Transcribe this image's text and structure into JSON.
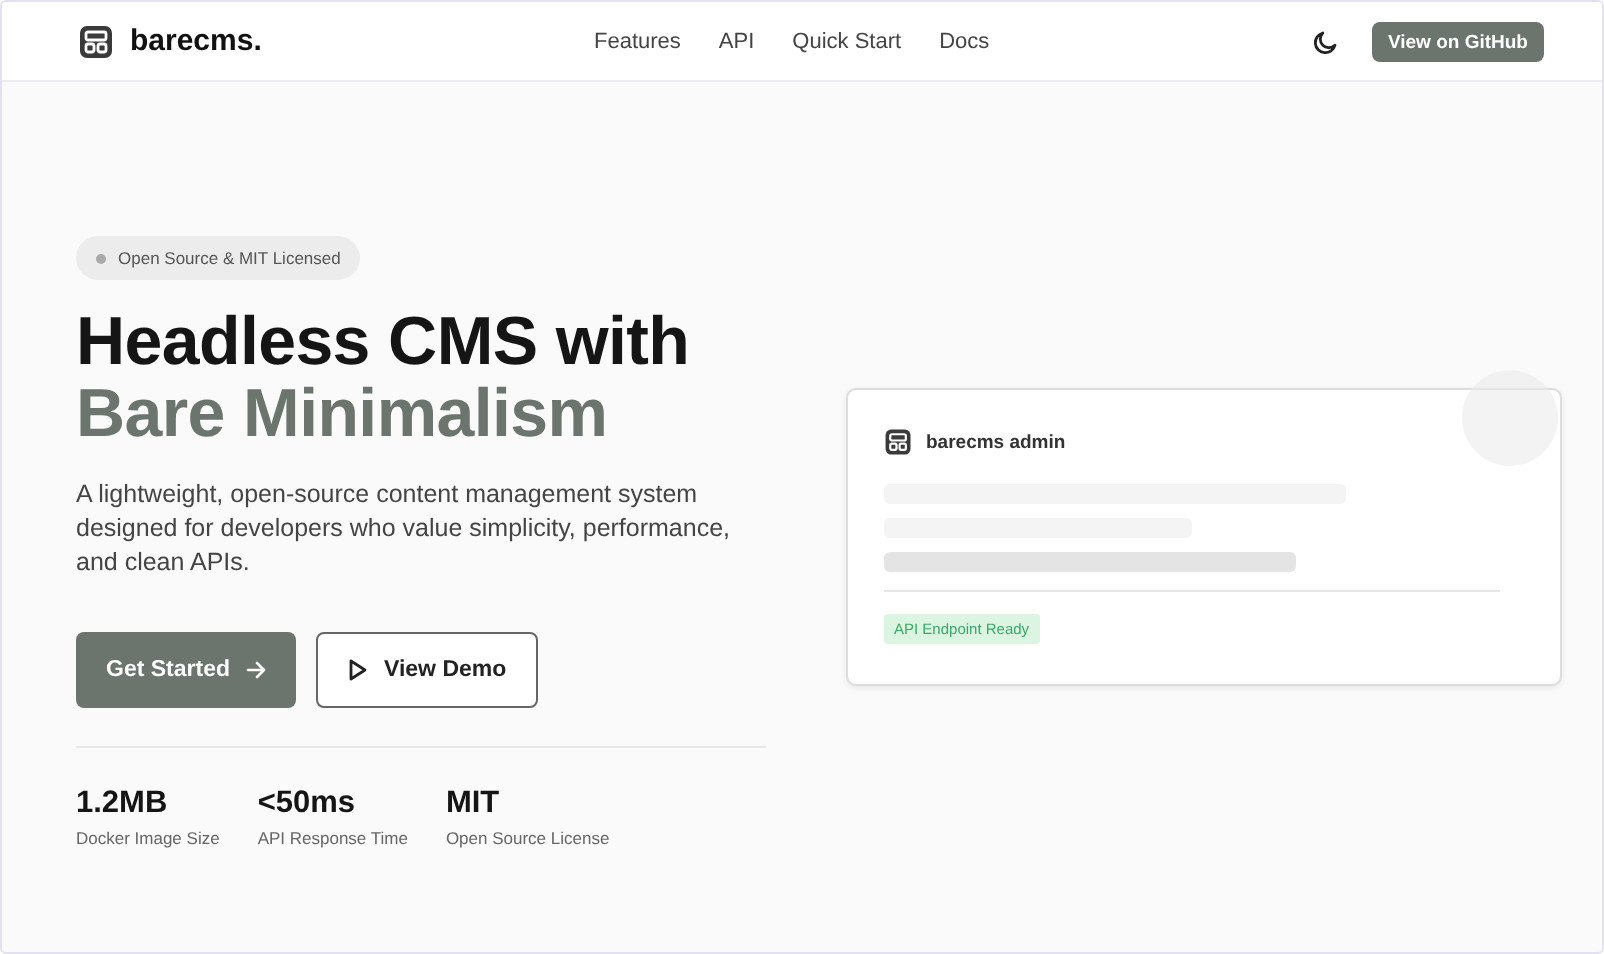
{
  "header": {
    "brand": "barecms.",
    "nav_links": [
      "Features",
      "API",
      "Quick Start",
      "Docs"
    ],
    "github_button": "View on GitHub"
  },
  "hero": {
    "badge": "Open Source & MIT Licensed",
    "title_line_1": "Headless CMS with",
    "title_line_2": "Bare Minimalism",
    "description": "A lightweight, open-source content management system designed for developers who value simplicity, performance, and clean APIs.",
    "buttons": [
      {
        "label": "Get Started",
        "kind": "primary"
      },
      {
        "label": "View Demo",
        "kind": "secondary"
      }
    ],
    "stats": [
      {
        "value": "1.2MB",
        "label": "Docker Image Size"
      },
      {
        "value": "<50ms",
        "label": "API Response Time"
      },
      {
        "value": "MIT",
        "label": "Open Source License"
      }
    ]
  },
  "preview_card": {
    "title": "barecms admin",
    "status": "API Endpoint Ready"
  }
}
